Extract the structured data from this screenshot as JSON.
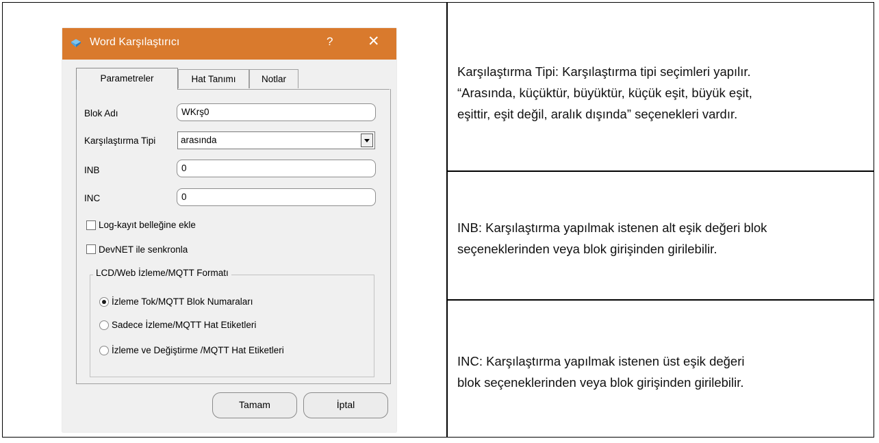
{
  "dialog": {
    "title": "Word Karşılaştırıcı",
    "help_glyph": "?",
    "close_glyph": "✕",
    "accent_color": "#d97a2d",
    "tabs": [
      {
        "label": "Parametreler"
      },
      {
        "label": "Hat Tanımı"
      },
      {
        "label": "Notlar"
      }
    ],
    "fields": {
      "block_name_label": "Blok Adı",
      "block_name_value": "WKrş0",
      "compare_type_label": "Karşılaştırma Tipi",
      "compare_type_value": "arasında",
      "inb_label": "INB",
      "inb_value": "0",
      "inc_label": "INC",
      "inc_value": "0"
    },
    "checkboxes": [
      {
        "label": "Log-kayıt belleğine ekle",
        "checked": false
      },
      {
        "label": "DevNET ile senkronla",
        "checked": false
      }
    ],
    "format_group": {
      "legend": "LCD/Web İzleme/MQTT Formatı",
      "options": [
        {
          "label": "İzleme Tok/MQTT Blok Numaraları",
          "selected": true
        },
        {
          "label": "Sadece İzleme/MQTT Hat Etiketleri",
          "selected": false
        },
        {
          "label": "İzleme ve Değiştirme /MQTT Hat Etiketleri",
          "selected": false
        }
      ]
    },
    "buttons": {
      "ok": "Tamam",
      "cancel": "İptal"
    }
  },
  "descriptions": [
    {
      "lines": [
        "Karşılaştırma Tipi:  Karşılaştırma tipi seçimleri yapılır.",
        "“Arasında, küçüktür, büyüktür, küçük eşit, büyük eşit,",
        "eşittir, eşit değil, aralık dışında” seçenekleri vardır."
      ]
    },
    {
      "lines": [
        "INB:  Karşılaştırma yapılmak istenen alt eşik değeri blok",
        "seçeneklerinden veya blok girişinden girilebilir."
      ]
    },
    {
      "lines": [
        "INC:  Karşılaştırma yapılmak istenen üst eşik değeri",
        "blok seçeneklerinden veya blok girişinden girilebilir."
      ]
    }
  ]
}
